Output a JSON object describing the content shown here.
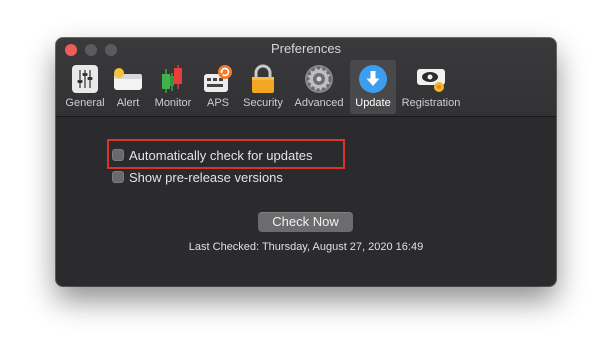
{
  "window": {
    "title": "Preferences"
  },
  "toolbar": {
    "tabs": [
      {
        "label": "General",
        "icon": "sliders-icon"
      },
      {
        "label": "Alert",
        "icon": "alert-banner-icon"
      },
      {
        "label": "Monitor",
        "icon": "candlestick-chart-icon"
      },
      {
        "label": "APS",
        "icon": "keyboard-refresh-icon"
      },
      {
        "label": "Security",
        "icon": "padlock-icon"
      },
      {
        "label": "Advanced",
        "icon": "gear-icon"
      },
      {
        "label": "Update",
        "icon": "download-arrow-icon",
        "active": true
      },
      {
        "label": "Registration",
        "icon": "registration-eye-icon"
      }
    ]
  },
  "update": {
    "auto_check_label": "Automatically check for updates",
    "auto_check_checked": false,
    "prerelease_label": "Show pre-release versions",
    "prerelease_checked": false,
    "check_now_label": "Check Now",
    "last_checked": "Last Checked: Thursday, August 27, 2020 16:49"
  },
  "colors": {
    "window_bg": "#2b2a2c",
    "highlight_border": "#d9342b",
    "update_icon": "#3d9ef0"
  }
}
